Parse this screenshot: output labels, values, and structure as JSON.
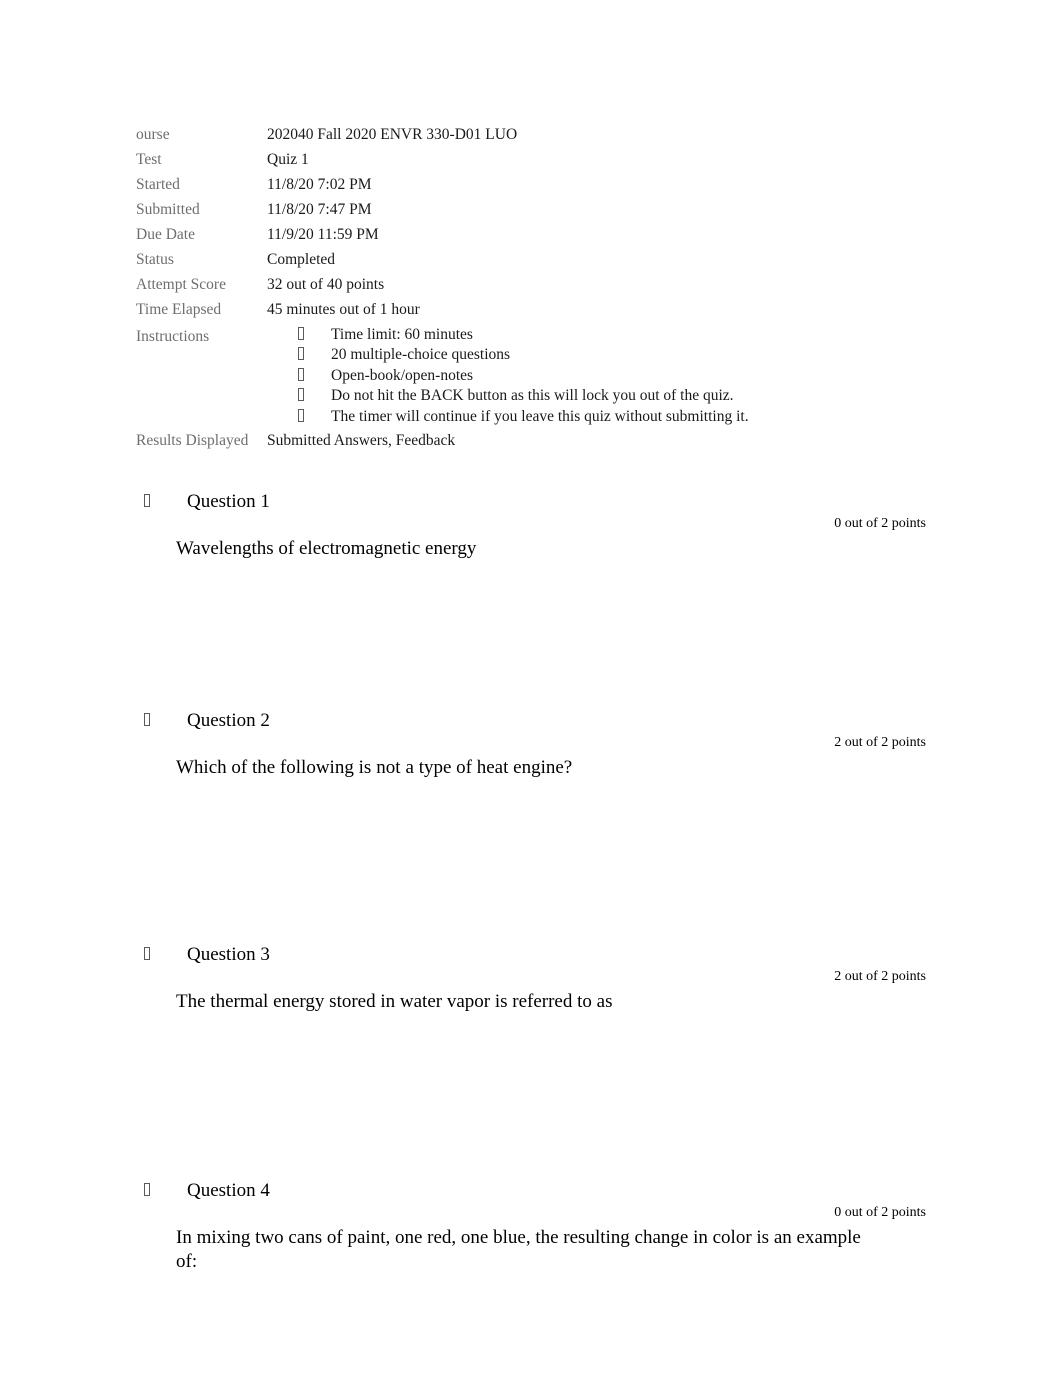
{
  "document": {
    "type": "quiz-results",
    "bullet_glyph": "missing-glyph-box"
  },
  "meta": {
    "rows": [
      {
        "label": "ourse",
        "value": "202040 Fall 2020 ENVR 330-D01 LUO"
      },
      {
        "label": "Test",
        "value": "Quiz 1"
      },
      {
        "label": "Started",
        "value": "11/8/20 7:02 PM"
      },
      {
        "label": "Submitted",
        "value": "11/8/20 7:47 PM"
      },
      {
        "label": "Due Date",
        "value": "11/9/20 11:59 PM"
      },
      {
        "label": "Status",
        "value": "Completed"
      },
      {
        "label": "Attempt Score",
        "value": "32 out of 40 points"
      },
      {
        "label": "Time Elapsed",
        "value": "45 minutes out of 1 hour"
      }
    ],
    "instructions_label": "Instructions",
    "instructions": [
      "Time limit: 60 minutes",
      "20 multiple-choice questions",
      "Open-book/open-notes",
      "Do not hit the BACK button as this will lock you out of the quiz.",
      "The timer will continue if you leave this quiz without submitting it."
    ],
    "results_displayed_label": "Results Displayed",
    "results_displayed_value": "Submitted Answers, Feedback"
  },
  "questions": [
    {
      "title": "Question 1",
      "points": "0 out of 2 points",
      "text_before": "Wavelengths of electromagnetic energy",
      "emphasis": "",
      "text_after": ""
    },
    {
      "title": "Question 2",
      "points": "2 out of 2 points",
      "text_before": "Which of the following is",
      "emphasis": "not",
      "text_after": "a type of heat engine?"
    },
    {
      "title": "Question 3",
      "points": "2 out of 2 points",
      "text_before": "The thermal energy stored in water vapor is referred to as",
      "emphasis": "",
      "text_after": ""
    },
    {
      "title": "Question 4",
      "points": "0 out of 2 points",
      "text_before": "In mixing two cans of paint, one red, one blue, the resulting change in color is an example of:",
      "emphasis": "",
      "text_after": ""
    }
  ]
}
